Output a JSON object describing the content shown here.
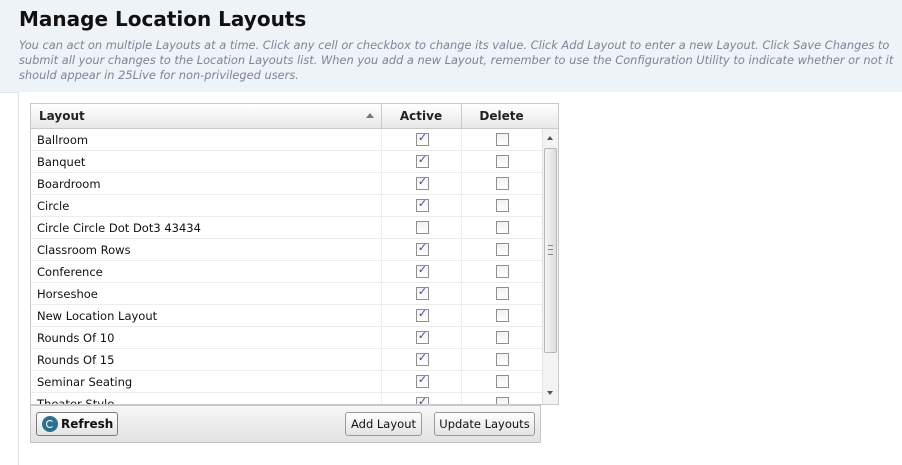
{
  "page": {
    "title": "Manage Location Layouts",
    "description": "You can act on multiple Layouts at a time. Click any cell or checkbox to change its value. Click Add Layout to enter a new Layout. Click Save Changes to submit all your changes to the Location Layouts list. When you add a new Layout, remember to use the Configuration Utility to indicate whether or not it should appear in 25Live for non-privileged users."
  },
  "grid": {
    "columns": {
      "layout": "Layout",
      "active": "Active",
      "delete": "Delete"
    },
    "rows": [
      {
        "name": "Ballroom",
        "active": true,
        "delete": false
      },
      {
        "name": "Banquet",
        "active": true,
        "delete": false
      },
      {
        "name": "Boardroom",
        "active": true,
        "delete": false
      },
      {
        "name": "Circle",
        "active": true,
        "delete": false
      },
      {
        "name": "Circle Circle Dot Dot3 43434",
        "active": false,
        "delete": false
      },
      {
        "name": "Classroom Rows",
        "active": true,
        "delete": false
      },
      {
        "name": "Conference",
        "active": true,
        "delete": false
      },
      {
        "name": "Horseshoe",
        "active": true,
        "delete": false
      },
      {
        "name": "New Location Layout",
        "active": true,
        "delete": false
      },
      {
        "name": "Rounds Of 10",
        "active": true,
        "delete": false
      },
      {
        "name": "Rounds Of 15",
        "active": true,
        "delete": false
      },
      {
        "name": "Seminar Seating",
        "active": true,
        "delete": false
      },
      {
        "name": "Theater Style",
        "active": true,
        "delete": false
      }
    ]
  },
  "footer": {
    "refresh_label": "Refresh",
    "add_label": "Add Layout",
    "update_label": "Update Layouts"
  },
  "icons": {
    "refresh": "refresh-icon",
    "check": "check-icon",
    "sort": "sort-ascending-icon"
  },
  "colors": {
    "header_bg": "#eef3f8",
    "description_text": "#7b8593",
    "refresh_icon": "#2d6f8f"
  }
}
